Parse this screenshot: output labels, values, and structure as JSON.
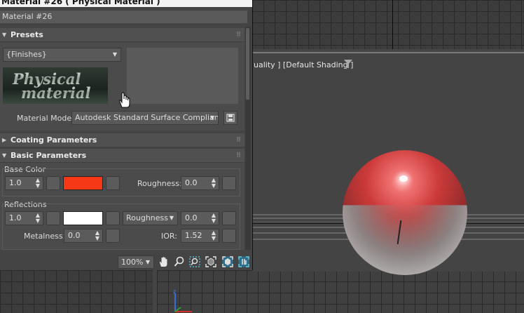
{
  "window": {
    "title": "Material #26  ( Physical Material )",
    "material_name": "Material #26"
  },
  "viewport": {
    "label": "uality ] [Default Shading ]"
  },
  "presets": {
    "header": "Presets",
    "dropdown_value": "{Finishes}",
    "logo_text_line1": "Physical",
    "logo_text_line2": "material",
    "mode_label": "Material Mode:",
    "mode_value": "Autodesk Standard Surface Compliant"
  },
  "coating": {
    "header": "Coating Parameters"
  },
  "basic": {
    "header": "Basic Parameters",
    "base_color_label": "Base Color",
    "base_weight": "1.0",
    "base_color_hex": "#f73816",
    "roughness_label": "Roughness:",
    "roughness_value": "0.0",
    "reflections_label": "Reflections",
    "refl_weight": "1.0",
    "refl_color_hex": "#ffffff",
    "refl_mode": "Roughness",
    "refl_roughness": "0.0",
    "metalness_label": "Metalness:",
    "metalness_value": "0.0",
    "ior_label": "IOR:",
    "ior_value": "1.52"
  },
  "toolbar": {
    "zoom": "100%",
    "icons": [
      "pan-hand-icon",
      "zoom-magnifier-icon",
      "zoom-region-icon",
      "zoom-extents-icon",
      "zoom-extents-selected-icon",
      "fit-view-icon"
    ]
  }
}
